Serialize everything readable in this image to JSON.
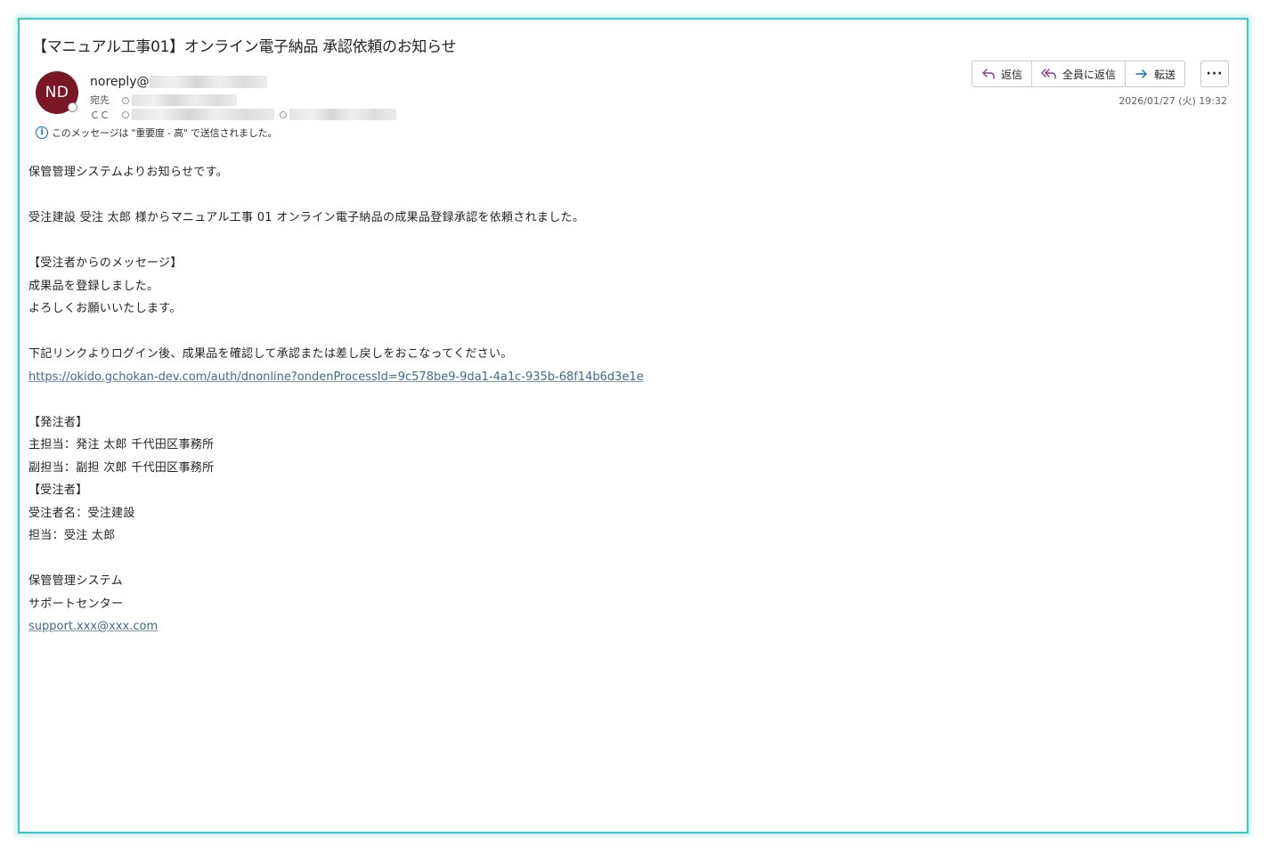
{
  "message": {
    "subject": "【マニュアル工事01】オンライン電子納品 承認依頼のお知らせ",
    "sender": {
      "initials": "ND",
      "name_prefix": "noreply@",
      "avatar_color": "#7a1724"
    },
    "to_label": "宛先",
    "cc_label": "ＣＣ",
    "importance_notice": "このメッセージは \"重要度 - 高\" で送信されました。",
    "timestamp": "2026/01/27 (火) 19:32"
  },
  "actions": {
    "reply": "返信",
    "reply_all": "全員に返信",
    "forward": "転送",
    "more": "···"
  },
  "body": {
    "greeting": "保管管理システムよりお知らせです。",
    "intro": "受注建設 受注 太郎 様からマニュアル工事 01 オンライン電子納品の成果品登録承認を依頼されました。",
    "msg_heading": "【受注者からのメッセージ】",
    "msg_line1": "成果品を登録しました。",
    "msg_line2": "よろしくお願いいたします。",
    "instruction": "下記リンクよりログイン後、成果品を確認して承認または差し戻しをおこなってください。",
    "link": "https://okido.gchokan-dev.com/auth/dnonline?ondenProcessId=9c578be9-9da1-4a1c-935b-68f14b6d3e1e",
    "orderer_heading": "【発注者】",
    "orderer_main": "主担当：発注 太郎 千代田区事務所",
    "orderer_sub": "副担当：副担 次郎 千代田区事務所",
    "contractor_heading": "【受注者】",
    "contractor_name": "受注者名：受注建設",
    "contractor_person": "担当：受注 太郎",
    "sig_system": "保管管理システム",
    "sig_center": "サポートセンター",
    "sig_email": "support.xxx@xxx.com"
  },
  "colors": {
    "frame_border": "#3cc8c4",
    "link": "#3d6a96",
    "reply_icon": "#8a3a8a",
    "forward_icon": "#0f6cbd"
  }
}
